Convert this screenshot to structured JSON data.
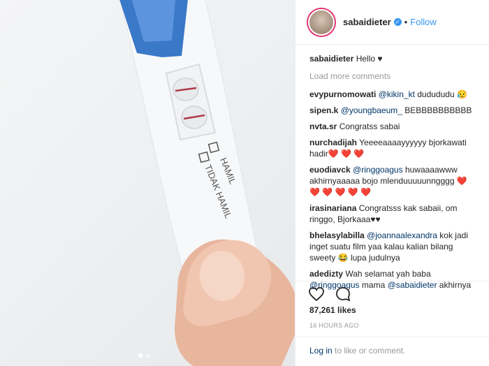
{
  "photo": {
    "stick_text_line1": "HAMIL",
    "stick_text_line2": "TIDAK HAMIL",
    "carousel_dots": 2
  },
  "header": {
    "username": "sabaidieter",
    "verified_glyph": "✓",
    "separator": "•",
    "follow_label": "Follow"
  },
  "caption": {
    "user": "sabaidieter",
    "text": "Hello",
    "emoji": "♥"
  },
  "load_more": "Load more comments",
  "comments": [
    {
      "user": "evypurnomowati",
      "mention": "@kikin_kt",
      "text": " dudududu 😥"
    },
    {
      "user": "sipen.k",
      "mention": "@youngbaeum_",
      "text": " BEBBBBBBBBBB"
    },
    {
      "user": "nvta.sr",
      "mention": "",
      "text": "Congratss sabai"
    },
    {
      "user": "nurchadijah",
      "mention": "",
      "text": "Yeeeeaaaayyyyyy bjorkawati hadir❤️ ❤️ ❤️"
    },
    {
      "user": "euodiavck",
      "mention": "@ringgoagus",
      "text": " huwaaaawww akhirnyaaaaa bojo mlenduuuuunngggg ❤️ ❤️ ❤️ ❤️ ❤️ ❤️"
    },
    {
      "user": "irasinariana",
      "mention": "",
      "text": "Congratsss kak sabaii, om ringgo, Bjorkaaa♥♥"
    },
    {
      "user": "bhelasylabilla",
      "mention": "@joannaalexandra",
      "text": " kok jadi inget suatu film yaa kalau kalian bilang sweety 😂 lupa judulnya"
    },
    {
      "user": "adedizty",
      "mention": "",
      "text": "Wah selamat yah baba ",
      "mention2": "@ringgoagus",
      "text2": " mama ",
      "mention3": "@sabaidieter",
      "text3": " akhirnya"
    }
  ],
  "actions": {
    "like_icon": "heart-icon",
    "comment_icon": "comment-icon"
  },
  "likes": "87,261 likes",
  "timestamp": "16 HOURS AGO",
  "login": {
    "link": "Log in",
    "rest": " to like or comment."
  }
}
